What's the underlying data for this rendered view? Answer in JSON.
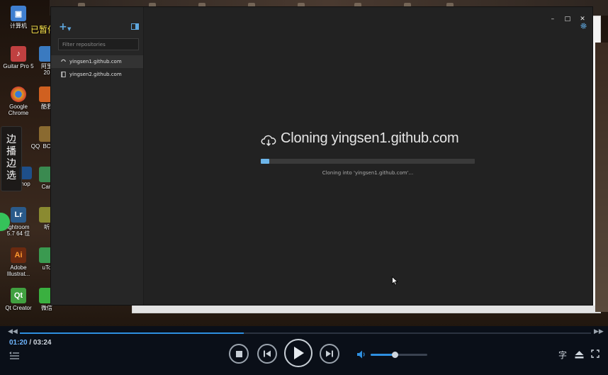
{
  "overlay": {
    "paused_label": "已暂停",
    "side_banner": [
      "边",
      "播",
      "边",
      "选"
    ]
  },
  "desktop_icons": [
    {
      "label": "计算机",
      "icon": "computer-icon",
      "color": "#3f7fd0"
    },
    {
      "label": "Guitar Pro 5",
      "icon": "guitar-pro-icon",
      "color": "#c04040"
    },
    {
      "label": "Google\nChrome",
      "icon": "chrome-icon",
      "color": "#e0a020"
    },
    {
      "label": "hop",
      "icon": "photoshop-icon",
      "color": "#1e4f8a"
    },
    {
      "label": "ightroom\n5.7 64 位",
      "icon": "lightroom-icon",
      "color": "#2a5a8a"
    },
    {
      "label": "Adobe\nIllustrat...",
      "icon": "illustrator-icon",
      "color": "#6a2a10"
    },
    {
      "label": "Qt Creator",
      "icon": "qt-creator-icon",
      "color": "#41a040"
    },
    {
      "label": "阿里\n20",
      "icon": "app-icon",
      "color": "#3a7ac0"
    },
    {
      "label": "酷我",
      "icon": "app-icon",
      "color": "#d06020"
    },
    {
      "label": "QQ",
      "icon": "qq-icon",
      "color": "#2a8ad0"
    },
    {
      "label": "BC",
      "icon": "app-icon",
      "color": "#8a6a30"
    },
    {
      "label": "Can",
      "icon": "app-icon",
      "color": "#3a8a50"
    },
    {
      "label": "听",
      "icon": "app-icon",
      "color": "#8a8a30"
    },
    {
      "label": "uTo",
      "icon": "app-icon",
      "color": "#3a9a50"
    },
    {
      "label": "微信",
      "icon": "wechat-icon",
      "color": "#3ab040"
    }
  ],
  "app": {
    "filter_placeholder": "Filter repositories",
    "repos": [
      {
        "name": "yingsen1.github.com",
        "icon": "sync-spinner-icon",
        "active": true
      },
      {
        "name": "yingsen2.github.com",
        "icon": "repo-icon",
        "active": false
      }
    ],
    "window_controls": [
      "–",
      "□",
      "✕"
    ],
    "clone_title": "Cloning yingsen1.github.com",
    "clone_status": "Cloning into 'yingsen1.github.com'...",
    "clone_progress": 0.04
  },
  "player": {
    "time_current": "01:20",
    "time_separator": " / ",
    "time_total": "03:24",
    "seek_progress": 0.392,
    "volume_level": 0.43,
    "subtitle_label": "字",
    "accent": "#2e8fe0"
  }
}
